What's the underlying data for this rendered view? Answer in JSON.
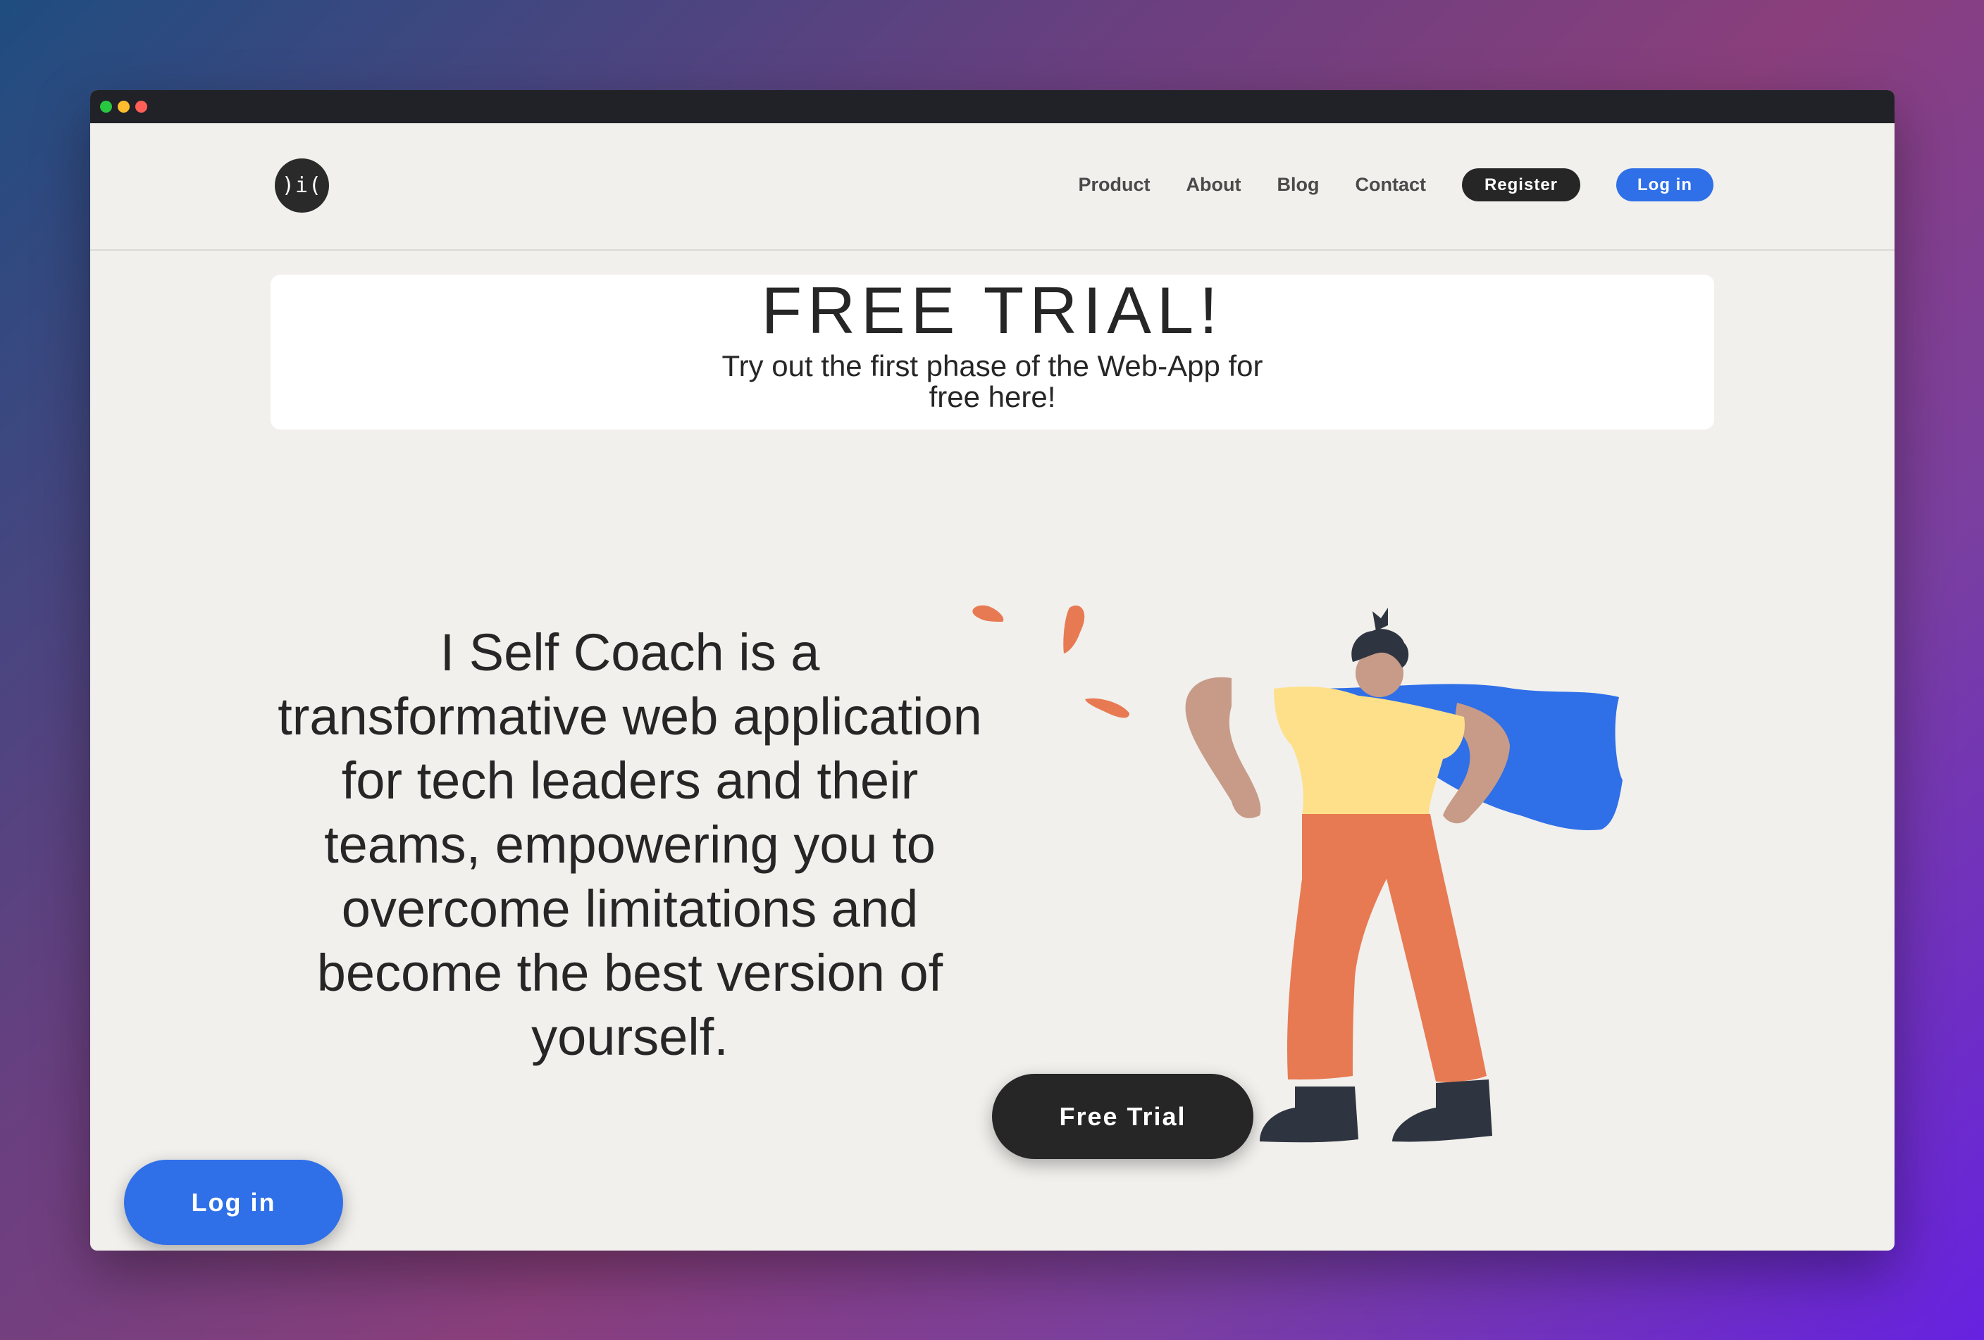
{
  "window": {
    "controls": [
      "close",
      "minimize",
      "maximize"
    ]
  },
  "header": {
    "logo_text": ")i(",
    "nav": [
      {
        "label": "Product"
      },
      {
        "label": "About"
      },
      {
        "label": "Blog"
      },
      {
        "label": "Contact"
      }
    ],
    "register_label": "Register",
    "login_label": "Log in"
  },
  "banner": {
    "title": "FREE TRIAL!",
    "subtitle": "Try out the first phase of the Web-App for free here!"
  },
  "hero": {
    "text": "I Self Coach is a transformative web application for tech leaders and their teams, empowering you to overcome limitations and become the best version of yourself.",
    "illustration": "superhero-woman-with-cape"
  },
  "cta": {
    "free_trial_label": "Free Trial",
    "floating_login_label": "Log in"
  },
  "colors": {
    "accent_blue": "#2f6fe8",
    "dark": "#262626",
    "page_bg": "#f1f0ed",
    "orange": "#e77a52",
    "yellow": "#fee08a",
    "skin": "#c79b87"
  }
}
